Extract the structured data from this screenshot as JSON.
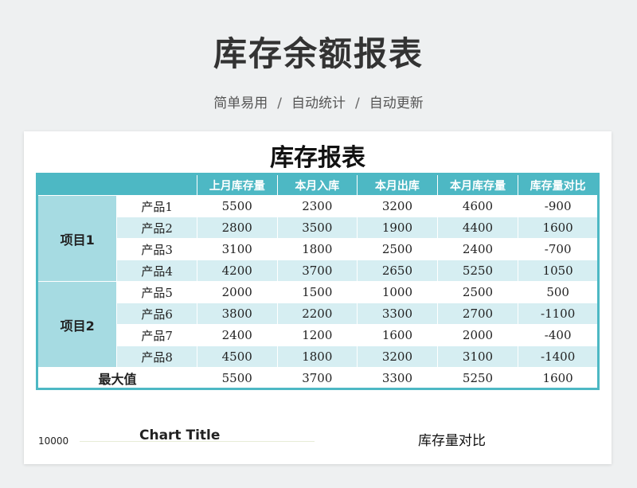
{
  "header": {
    "title": "库存余额报表",
    "subtitle": [
      "简单易用",
      "自动统计",
      "自动更新"
    ],
    "separator": "/"
  },
  "sheet": {
    "title": "库存报表",
    "columns": [
      "上月库存量",
      "本月入库",
      "本月出库",
      "本月库存量",
      "库存量对比"
    ],
    "groups": [
      {
        "name": "项目1",
        "rows": [
          {
            "product": "产品1",
            "values": [
              "5500",
              "2300",
              "3200",
              "4600",
              "-900"
            ]
          },
          {
            "product": "产品2",
            "values": [
              "2800",
              "3500",
              "1900",
              "4400",
              "1600"
            ]
          },
          {
            "product": "产品3",
            "values": [
              "3100",
              "1800",
              "2500",
              "2400",
              "-700"
            ]
          },
          {
            "product": "产品4",
            "values": [
              "4200",
              "3700",
              "2650",
              "5250",
              "1050"
            ]
          }
        ]
      },
      {
        "name": "项目2",
        "rows": [
          {
            "product": "产品5",
            "values": [
              "2000",
              "1500",
              "1000",
              "2500",
              "500"
            ]
          },
          {
            "product": "产品6",
            "values": [
              "3800",
              "2200",
              "3300",
              "2700",
              "-1100"
            ]
          },
          {
            "product": "产品7",
            "values": [
              "2400",
              "1200",
              "1600",
              "2000",
              "-400"
            ]
          },
          {
            "product": "产品8",
            "values": [
              "4500",
              "1800",
              "3200",
              "3100",
              "-1400"
            ]
          }
        ]
      }
    ],
    "max_row": {
      "label": "最大值",
      "values": [
        "5500",
        "3700",
        "3300",
        "5250",
        "1600"
      ]
    }
  },
  "charts": {
    "left_axis_label": "10000",
    "left_title": "Chart Title",
    "right_title": "库存量对比"
  },
  "colors": {
    "accent": "#4db8c4",
    "group_fill": "#a6dbe2",
    "stripe": "#d6eef2"
  }
}
